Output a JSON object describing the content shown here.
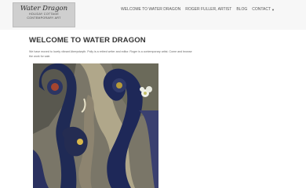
{
  "logo": {
    "title": "Water Dragon",
    "line1": "HOLIDAY COTTAGE",
    "line2": "CONTEMPORARY ART"
  },
  "nav": {
    "items": [
      {
        "label": "WELCOME TO WATER DRAGON"
      },
      {
        "label": "ROGER FULLER, ARTIST"
      },
      {
        "label": "BLOG"
      },
      {
        "label": "CONTACT",
        "has_dropdown": true
      }
    ]
  },
  "main": {
    "title": "WELCOME TO WATER DRAGON",
    "intro": "We have moved to lovely vibrant Aberystwyth. Polly is a retired writer and editor. Roger is a contemporary artist. Come and browse the work for sale.",
    "artwork_icon": "abstract-painting"
  }
}
